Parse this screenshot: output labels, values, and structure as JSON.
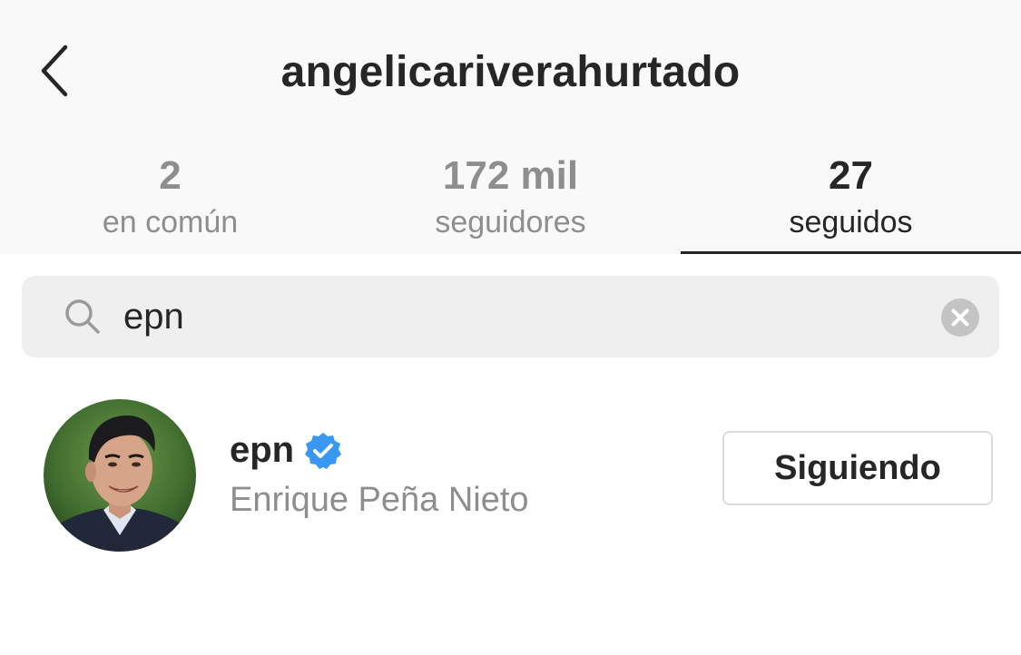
{
  "header": {
    "title": "angelicariverahurtado",
    "back_icon": "chevron-left-icon"
  },
  "tabs": [
    {
      "count": "2",
      "label": "en común",
      "active": false
    },
    {
      "count": "172 mil",
      "label": "seguidores",
      "active": false
    },
    {
      "count": "27",
      "label": "seguidos",
      "active": true
    }
  ],
  "search": {
    "value": "epn",
    "icon": "search-icon",
    "clear_icon": "clear-icon"
  },
  "results": [
    {
      "username": "epn",
      "verified": true,
      "full_name": "Enrique Peña Nieto",
      "button_label": "Siguiendo"
    }
  ],
  "colors": {
    "text_primary": "#262626",
    "text_secondary": "#8e8e8e",
    "verified_blue": "#3897f0",
    "header_bg": "#f9f9f9",
    "search_bg": "#efefef",
    "button_border": "#dbdbdb"
  }
}
